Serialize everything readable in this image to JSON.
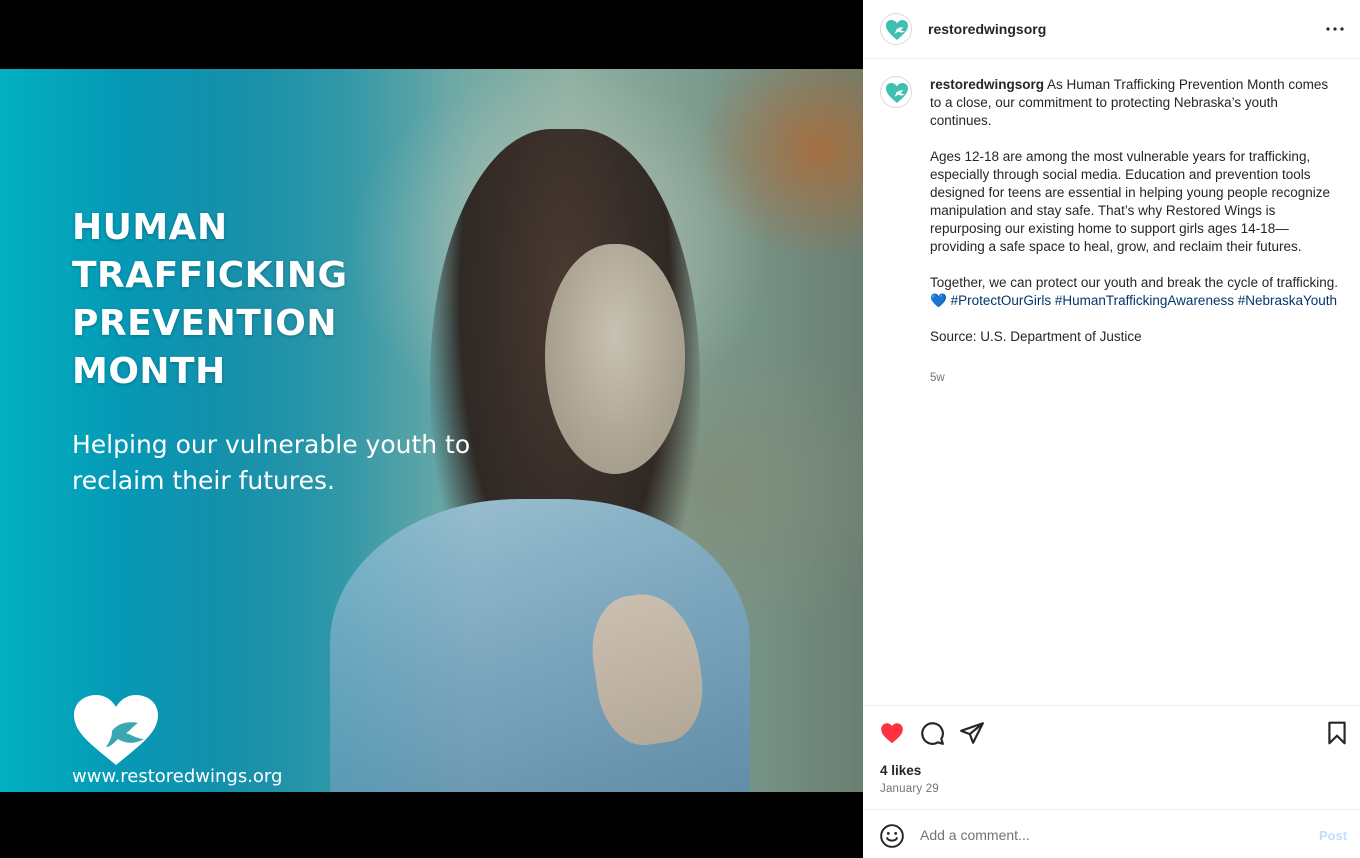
{
  "media": {
    "title": "HUMAN TRAFFICKING PREVENTION MONTH",
    "subtitle": "Helping our vulnerable youth to reclaim their futures.",
    "url": "www.restoredwings.org",
    "logo_icon": "heart-dove-icon"
  },
  "header": {
    "username": "restoredwingsorg",
    "more_icon": "more-options-icon"
  },
  "caption": {
    "username": "restoredwingsorg",
    "paragraph1": "As Human Trafficking Prevention Month comes to a close, our commitment to protecting Nebraska’s youth continues.",
    "paragraph2": "Ages 12-18 are among the most vulnerable years for trafficking, especially through social media. Education and prevention tools designed for teens are essential in helping young people recognize manipulation and stay safe. That’s why Restored Wings is repurposing our existing home to support girls ages 14-18—providing a safe space to heal, grow, and reclaim their futures.",
    "paragraph3_text": "Together, we can protect our youth and break the cycle of trafficking.",
    "heart_emoji": "💙",
    "hashtags": [
      "#ProtectOurGirls",
      "#HumanTraffickingAwareness",
      "#NebraskaYouth"
    ],
    "source": "Source: U.S. Department of Justice",
    "time": "5w"
  },
  "actions": {
    "likes": "4 likes",
    "date": "January 29",
    "liked": true,
    "like_color": "#ff3040"
  },
  "comment": {
    "placeholder": "Add a comment...",
    "post_label": "Post"
  }
}
